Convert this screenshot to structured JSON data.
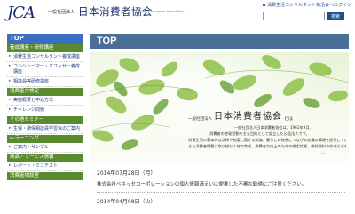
{
  "header": {
    "logo_mark": "JCA",
    "logo_sub": "一般社団法人",
    "logo_name": "日本消費者協会",
    "logo_en": "Japan Consumers' Association",
    "top_link": "消費生活コンサルタント備沿会ヘログイン",
    "search_button": "検索",
    "search_placeholder": ""
  },
  "sidebar": {
    "top_label": "TOP",
    "sections": [
      {
        "heading": "養成講座・研修講座",
        "items": [
          "消費生活コンサルタント養成講座",
          "コンシューマー・オフィサー養成講座",
          "相談員等研修講座"
        ]
      },
      {
        "heading": "消費者力検定",
        "items": [
          "実施概要と申込方法",
          "チャレンジ問題"
        ]
      },
      {
        "heading": "その他セミナー",
        "items": [
          "生保・損保相談員学習会のご案内"
        ]
      },
      {
        "heading": "e-ラーニング",
        "items": [
          "ご案内・サンプル"
        ]
      },
      {
        "heading": "商品・サービス情報",
        "items": [
          "レポート・ミニテスト"
        ]
      },
      {
        "heading": "消費者相談室",
        "items": []
      }
    ]
  },
  "main": {
    "banner_title": "TOP",
    "hero": {
      "prefix": "一般社団法人",
      "name": "日本消費者協会",
      "suffix": "とは",
      "lines": [
        "一般社団法人日本消費者協会は、1961年9月、",
        "消費者の啓発活動を主な目的として設立した公益法人です。",
        "消費生活の基本的な法律や制度に関する知識、暮らしの改善につながる各種の情報を提供しています。",
        "また消費者問題に取り組む人材の育成、消費者力向上のための検定試験、啓発資料の作成などを行っております。",
        "..."
      ]
    },
    "news": [
      {
        "date": "2014年07月28日（月）",
        "body": "株式会社ベネッセコーポレーションの個人情報漏えいに便乗した不審な勧誘にご注意ください。"
      },
      {
        "date": "2014年04月08日（火）",
        "body": ""
      }
    ]
  }
}
